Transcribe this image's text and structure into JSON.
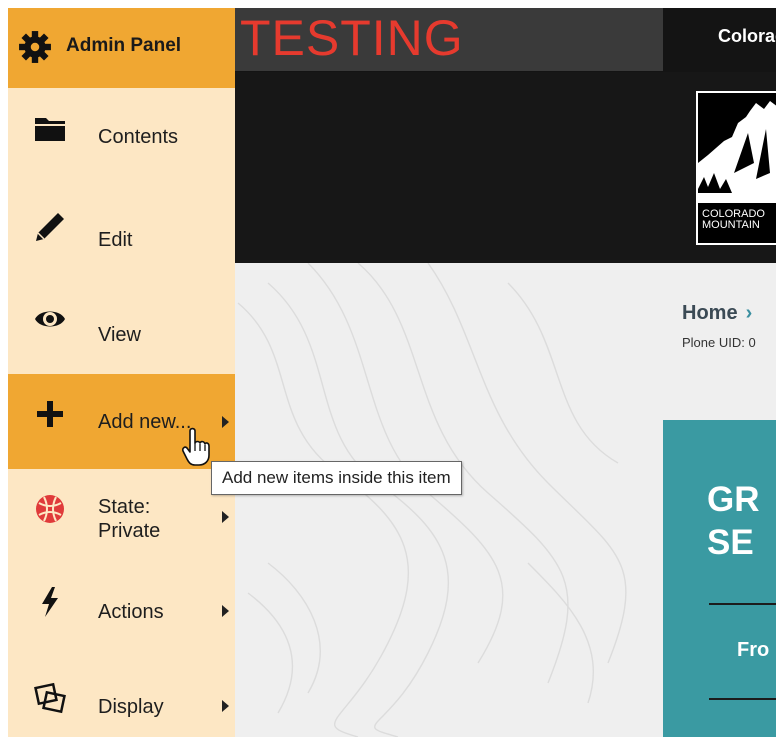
{
  "site": {
    "testing_banner": "TESTING",
    "site_name": "Colorado",
    "logo_text": "COLORADO\nMOUNTAIN",
    "breadcrumb_home": "Home",
    "breadcrumb_sep": "›",
    "plone_uid": "Plone UID: 0",
    "card_title": "GR\nSE",
    "card_subtitle": "Fro"
  },
  "toolbar": {
    "title": "Admin Panel",
    "items": [
      {
        "label": "Contents",
        "icon": "folder-icon",
        "submenu": false,
        "active": false
      },
      {
        "label": "Edit",
        "icon": "pencil-icon",
        "submenu": false,
        "active": false
      },
      {
        "label": "View",
        "icon": "eye-icon",
        "submenu": false,
        "active": false
      },
      {
        "label": "Add new...",
        "icon": "plus-icon",
        "submenu": true,
        "active": true
      },
      {
        "label": "State:\nPrivate",
        "icon": "state-private-icon",
        "submenu": true,
        "active": false
      },
      {
        "label": "Actions",
        "icon": "lightning-icon",
        "submenu": true,
        "active": false
      },
      {
        "label": "Display",
        "icon": "display-icon",
        "submenu": true,
        "active": false
      }
    ],
    "tooltip": "Add new items inside this item"
  },
  "colors": {
    "toolbar_bg": "#fde7c4",
    "toolbar_accent": "#f0a732",
    "testing_red": "#e63a2e",
    "teal": "#3a9aa2"
  }
}
